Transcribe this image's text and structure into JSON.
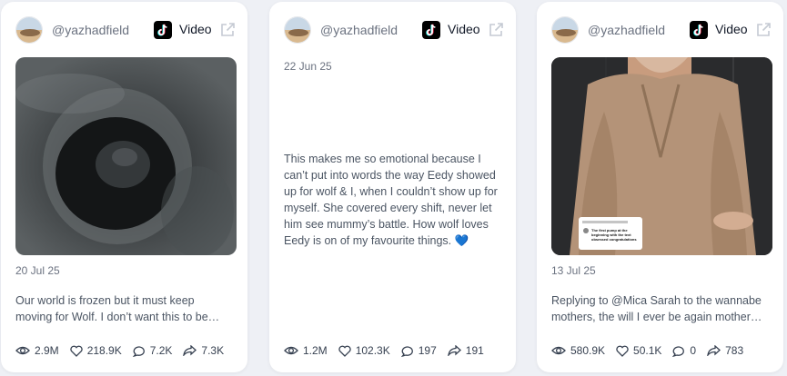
{
  "cards": [
    {
      "handle": "@yazhadfield",
      "type_label": "Video",
      "date": "20 Jul 25",
      "caption": "Our world is frozen but it must keep moving for Wolf. I don’t want this to be…",
      "stats": {
        "views": "2.9M",
        "likes": "218.9K",
        "comments": "7.2K",
        "shares": "7.3K"
      }
    },
    {
      "handle": "@yazhadfield",
      "type_label": "Video",
      "date": "22 Jun 25",
      "caption": "This makes me so emotional because I can’t put into words the way Eedy showed up for wolf & I, when I couldn’t show up for myself. She covered every shift, never let him see mummy’s battle. How wolf loves Eedy is on of my favourite things. 💙",
      "stats": {
        "views": "1.2M",
        "likes": "102.3K",
        "comments": "197",
        "shares": "191"
      }
    },
    {
      "handle": "@yazhadfield",
      "type_label": "Video",
      "date": "13 Jul 25",
      "caption": "Replying to @Mica Sarah to the wannabe mothers, the will I ever be again mother…",
      "stats": {
        "views": "580.9K",
        "likes": "50.1K",
        "comments": "0",
        "shares": "783"
      }
    }
  ],
  "overlay_comment": "The first pump at the beginning with the text obsessed congratulations",
  "colors": {
    "accent": "#4a90d9",
    "card_bg": "#ffffff",
    "page_bg": "#eef0f5",
    "muted": "#6b7280"
  }
}
